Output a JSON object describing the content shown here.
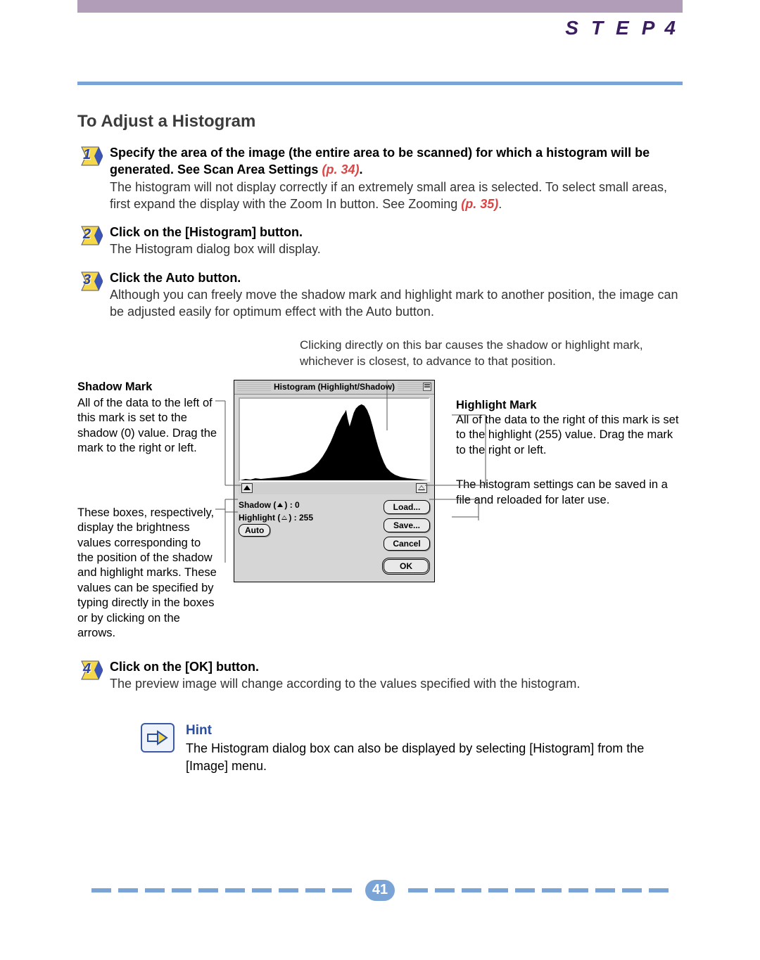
{
  "header": {
    "step_label": "STEP",
    "step_number": "4"
  },
  "title": "To Adjust a Histogram",
  "steps": [
    {
      "num": "1",
      "bold_a": "Specify the area of the image (the entire area to be scanned) for which a histogram will be generated. See Scan Area Settings ",
      "link_a": "(p. 34)",
      "bold_b": ".",
      "body_a": "The histogram will not display correctly if an extremely small area is selected. To select small areas, first expand the display with the Zoom In button. See Zooming ",
      "link_b": "(p. 35)",
      "body_b": "."
    },
    {
      "num": "2",
      "bold_a": "Click on the [Histogram] button.",
      "body_a": "The Histogram dialog box will display."
    },
    {
      "num": "3",
      "bold_a": "Click the Auto button.",
      "body_a": "Although you can freely move the shadow mark and highlight mark to another position, the image can be adjusted easily for optimum effect with the Auto button."
    },
    {
      "num": "4",
      "bold_a": "Click on the [OK] button.",
      "body_a": "The preview image will change according to the values specified with the histogram."
    }
  ],
  "top_caption": "Clicking directly on this bar causes the shadow or highlight mark, whichever is closest, to advance to that position.",
  "annotations": {
    "shadow_mark_title": "Shadow Mark",
    "shadow_mark_body": "All of the data to the left of this mark is set to the shadow (0) value. Drag the mark to the right or left.",
    "boxes_body": "These boxes, respectively, display the brightness values corresponding to the position of the shadow and highlight marks. These values can be specified by typing directly in the boxes or by clicking on the arrows.",
    "highlight_mark_title": "Highlight Mark",
    "highlight_mark_body": "All of the data to the right of this mark is set to the highlight (255) value. Drag the mark to the right or left.",
    "save_body": "The histogram settings can be saved in a file and reloaded for later use."
  },
  "dialog": {
    "title": "Histogram (Highlight/Shadow)",
    "shadow_label": "Shadow",
    "shadow_value": "0",
    "highlight_label": "Highlight",
    "highlight_value": "255",
    "buttons": {
      "load": "Load...",
      "save": "Save...",
      "cancel": "Cancel",
      "auto": "Auto",
      "ok": "OK"
    }
  },
  "hint": {
    "title": "Hint",
    "body": "The Histogram dialog box can also be displayed by selecting [Histogram] from the [Image] menu."
  },
  "page_number": "41"
}
